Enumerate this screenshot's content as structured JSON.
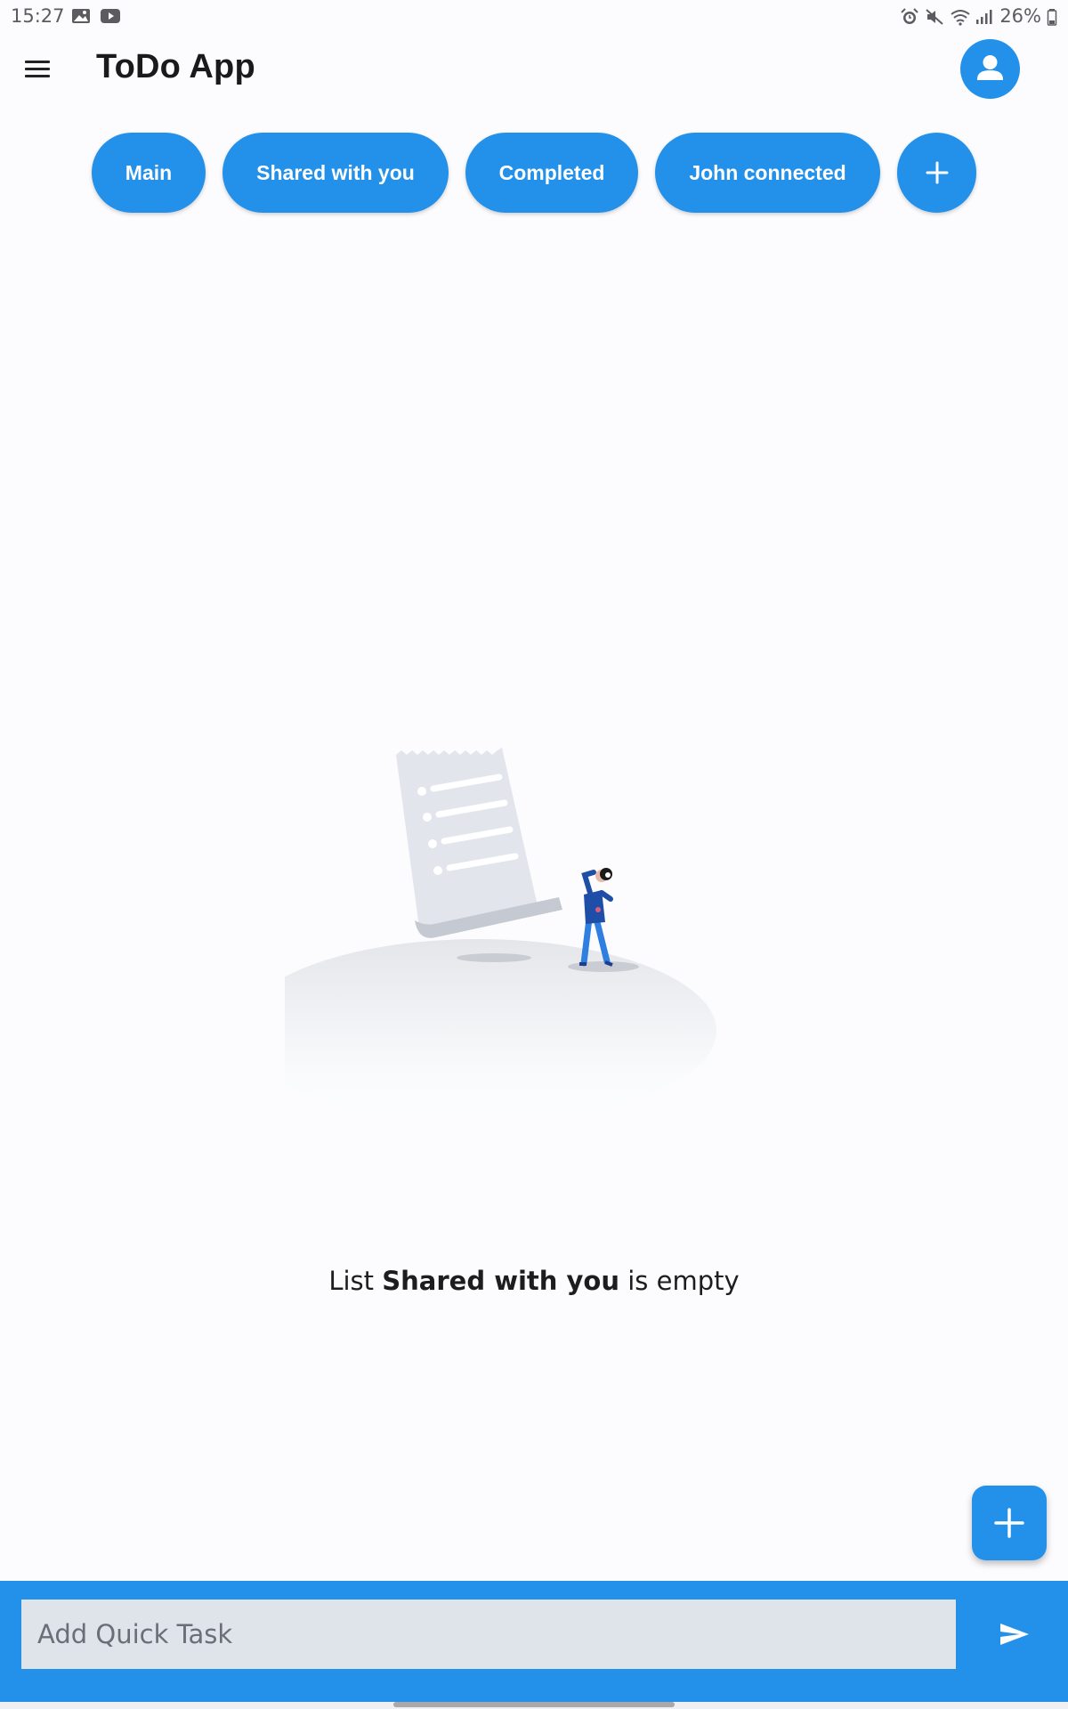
{
  "status_bar": {
    "time": "15:27",
    "left_icons": [
      "image-icon",
      "youtube-icon"
    ],
    "right_icons": [
      "alarm-icon",
      "mute-icon",
      "wifi-icon",
      "signal-icon"
    ],
    "battery": "26%"
  },
  "app_bar": {
    "menu_icon": "menu-icon",
    "title": "ToDo App",
    "account_icon": "person-icon"
  },
  "lists": {
    "chips": [
      {
        "label": "Main"
      },
      {
        "label": "Shared with you"
      },
      {
        "label": "Completed"
      },
      {
        "label": "John connected"
      }
    ],
    "add_icon": "plus-icon"
  },
  "empty_state": {
    "prefix": "List",
    "list_name": "Shared with you",
    "suffix": "is empty"
  },
  "fab": {
    "icon": "plus-icon"
  },
  "quick_task": {
    "placeholder": "Add Quick Task",
    "value": "",
    "send_icon": "send-icon"
  },
  "colors": {
    "accent": "#2391ea",
    "background": "#fcfcfe",
    "input_background": "#dfe3ea"
  }
}
